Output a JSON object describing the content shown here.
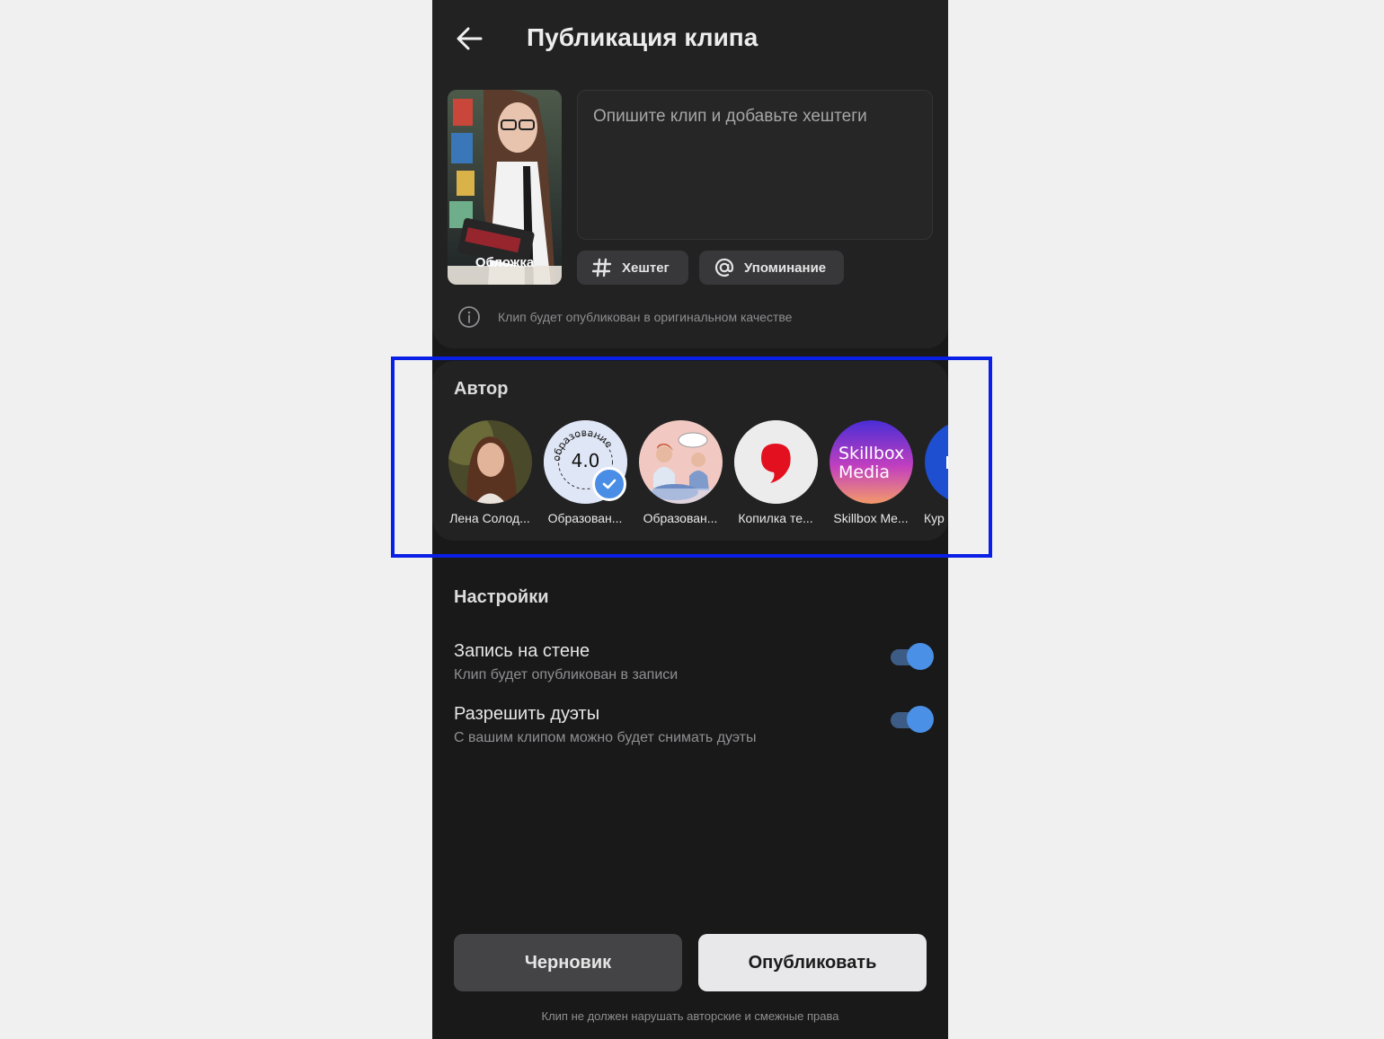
{
  "header": {
    "title": "Публикация клипа"
  },
  "cover": {
    "label": "Обложка"
  },
  "description": {
    "placeholder": "Опишите клип и добавьте хештеги",
    "value": ""
  },
  "chips": {
    "hashtag": "Хештег",
    "mention": "Упоминание"
  },
  "quality_note": "Клип будет опубликован в оригинальном качестве",
  "author": {
    "title": "Автор",
    "items": [
      {
        "name": "Лена Солод..."
      },
      {
        "name": "Образован...",
        "avatar_text": "4.0",
        "avatar_ring_text": "образование",
        "verified": true
      },
      {
        "name": "Образован..."
      },
      {
        "name": "Копилка те..."
      },
      {
        "name": "Skillbox Me...",
        "avatar_text_1": "Skillbox",
        "avatar_text_2": "Media"
      },
      {
        "name": "Кур"
      }
    ]
  },
  "settings": {
    "title": "Настройки",
    "items": [
      {
        "title": "Запись на стене",
        "subtitle": "Клип будет опубликован в записи",
        "enabled": true
      },
      {
        "title": "Разрешить дуэты",
        "subtitle": "С вашим клипом можно будет снимать дуэты",
        "enabled": true
      }
    ]
  },
  "actions": {
    "draft": "Черновик",
    "publish": "Опубликовать"
  },
  "footnote": "Клип не должен нарушать авторские и смежные права",
  "colors": {
    "accent": "#4a90e6",
    "highlight": "#0a1fe6"
  }
}
